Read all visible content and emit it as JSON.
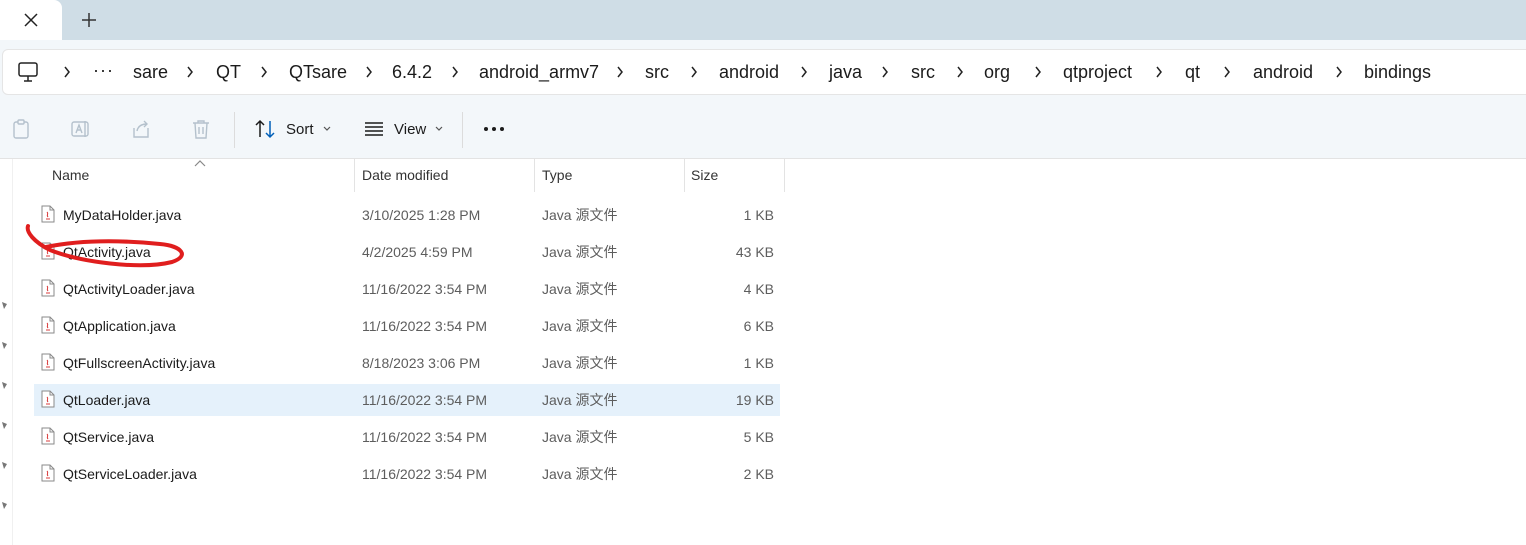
{
  "breadcrumb": {
    "overflow": "···",
    "segments": [
      "sare",
      "QT",
      "QTsare",
      "6.4.2",
      "android_armv7",
      "src",
      "android",
      "java",
      "src",
      "org",
      "qtproject",
      "qt",
      "android",
      "bindings"
    ]
  },
  "toolbar": {
    "sort_label": "Sort",
    "view_label": "View"
  },
  "columns": {
    "name": "Name",
    "date": "Date modified",
    "type": "Type",
    "size": "Size"
  },
  "files": [
    {
      "name": "MyDataHolder.java",
      "date": "3/10/2025 1:28 PM",
      "type": "Java 源文件",
      "size": "1 KB"
    },
    {
      "name": "QtActivity.java",
      "date": "4/2/2025 4:59 PM",
      "type": "Java 源文件",
      "size": "43 KB"
    },
    {
      "name": "QtActivityLoader.java",
      "date": "11/16/2022 3:54 PM",
      "type": "Java 源文件",
      "size": "4 KB"
    },
    {
      "name": "QtApplication.java",
      "date": "11/16/2022 3:54 PM",
      "type": "Java 源文件",
      "size": "6 KB"
    },
    {
      "name": "QtFullscreenActivity.java",
      "date": "8/18/2023 3:06 PM",
      "type": "Java 源文件",
      "size": "1 KB"
    },
    {
      "name": "QtLoader.java",
      "date": "11/16/2022 3:54 PM",
      "type": "Java 源文件",
      "size": "19 KB"
    },
    {
      "name": "QtService.java",
      "date": "11/16/2022 3:54 PM",
      "type": "Java 源文件",
      "size": "5 KB"
    },
    {
      "name": "QtServiceLoader.java",
      "date": "11/16/2022 3:54 PM",
      "type": "Java 源文件",
      "size": "2 KB"
    }
  ],
  "selected_file": "QtLoader.java",
  "colors": {
    "accent": "#005fb8",
    "selection": "#e5f1fb",
    "annotation": "#e01e1e"
  }
}
